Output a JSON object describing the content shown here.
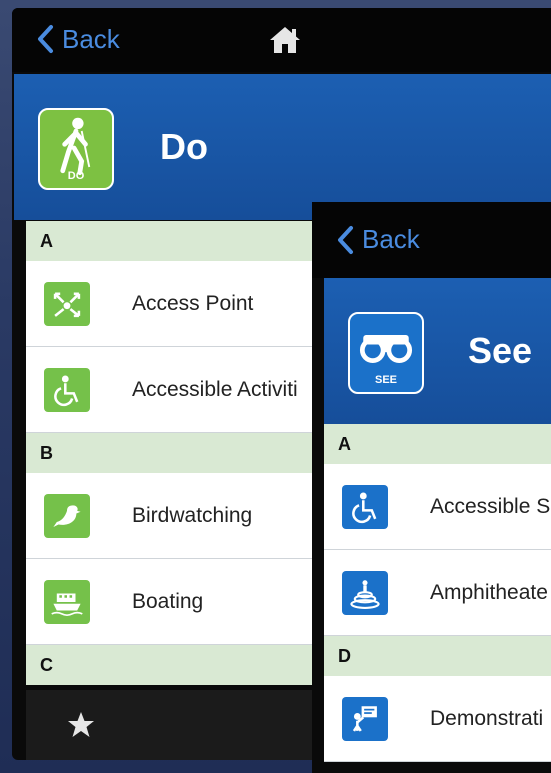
{
  "back_screen": {
    "nav": {
      "back_label": "Back"
    },
    "header": {
      "title": "Do",
      "icon_caption": "DO"
    },
    "sections": [
      {
        "letter": "A",
        "items": [
          {
            "label": "Access Point",
            "icon": "access-point-icon"
          },
          {
            "label": "Accessible Activiti",
            "icon": "wheelchair-icon"
          }
        ]
      },
      {
        "letter": "B",
        "items": [
          {
            "label": "Birdwatching",
            "icon": "bird-icon"
          },
          {
            "label": "Boating",
            "icon": "boat-icon"
          }
        ]
      },
      {
        "letter": "C",
        "items": []
      }
    ],
    "tabbar": {
      "icon": "star-icon"
    }
  },
  "front_screen": {
    "nav": {
      "back_label": "Back"
    },
    "header": {
      "title": "See",
      "icon_caption": "SEE"
    },
    "sections": [
      {
        "letter": "A",
        "items": [
          {
            "label": "Accessible S",
            "icon": "wheelchair-icon"
          },
          {
            "label": "Amphitheate",
            "icon": "amphitheater-icon"
          }
        ]
      },
      {
        "letter": "D",
        "items": [
          {
            "label": "Demonstrati",
            "icon": "demonstration-icon"
          }
        ]
      }
    ]
  },
  "colors": {
    "accent_blue": "#1c5fb2",
    "do_green": "#75c14a",
    "see_blue": "#1b71c9",
    "section_bg": "#d9e9d3",
    "link_blue": "#4a8ce0"
  }
}
